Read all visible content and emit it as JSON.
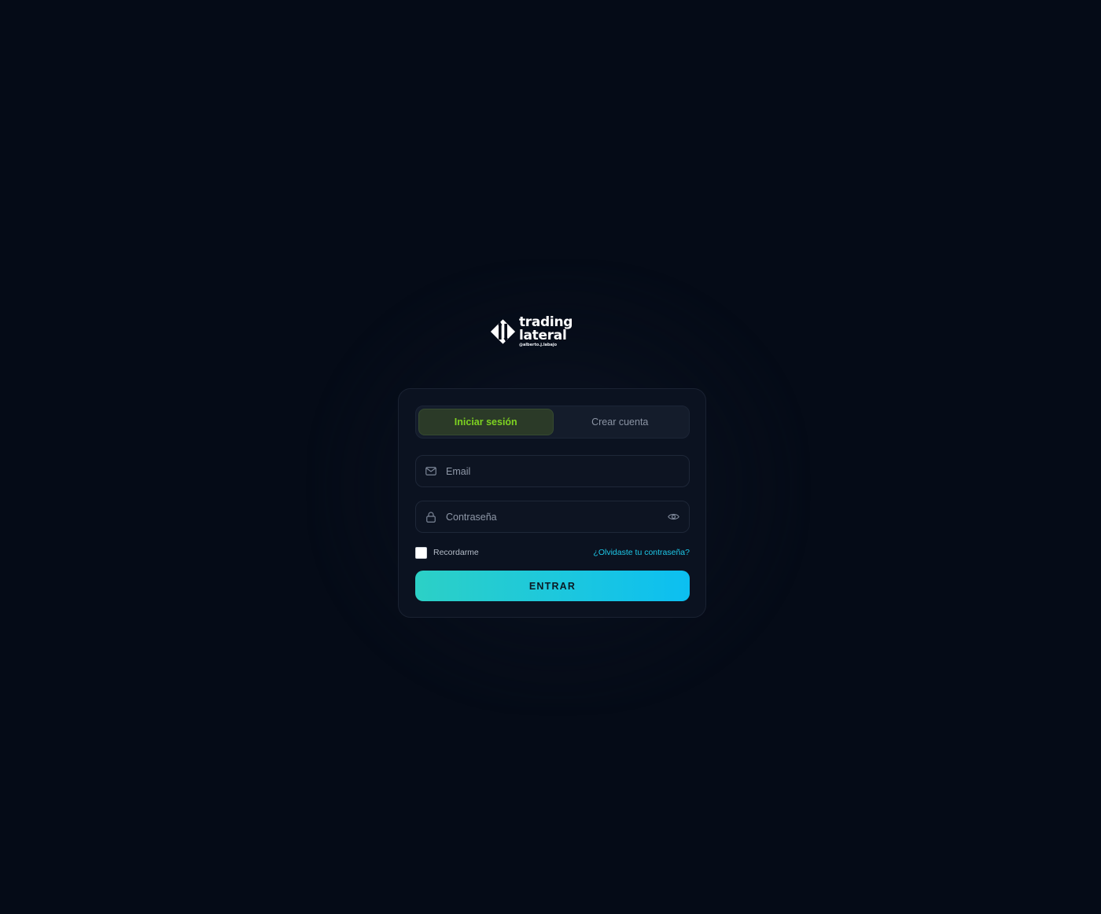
{
  "brand": {
    "title": "trading lateral",
    "subtitle": "@alberto.j.labajo"
  },
  "tabs": [
    {
      "label": "Iniciar sesión",
      "active": true
    },
    {
      "label": "Crear cuenta",
      "active": false
    }
  ],
  "form": {
    "email": {
      "placeholder": "Email",
      "icon": "mail-icon"
    },
    "password": {
      "placeholder": "Contraseña",
      "icon": "lock-icon",
      "toggle_icon": "eye-icon"
    },
    "remember_label": "Recordarme",
    "remember_checked": false,
    "forgot_label": "¿Olvidaste tu contraseña?",
    "submit_label": "ENTRAR"
  },
  "colors": {
    "background": "#050b17",
    "card": "#0b1220",
    "accent_green": "#7ed321",
    "accent_cyan": "#1ec8e8",
    "button_start": "#2cd0c6",
    "button_end": "#0cbff1"
  }
}
